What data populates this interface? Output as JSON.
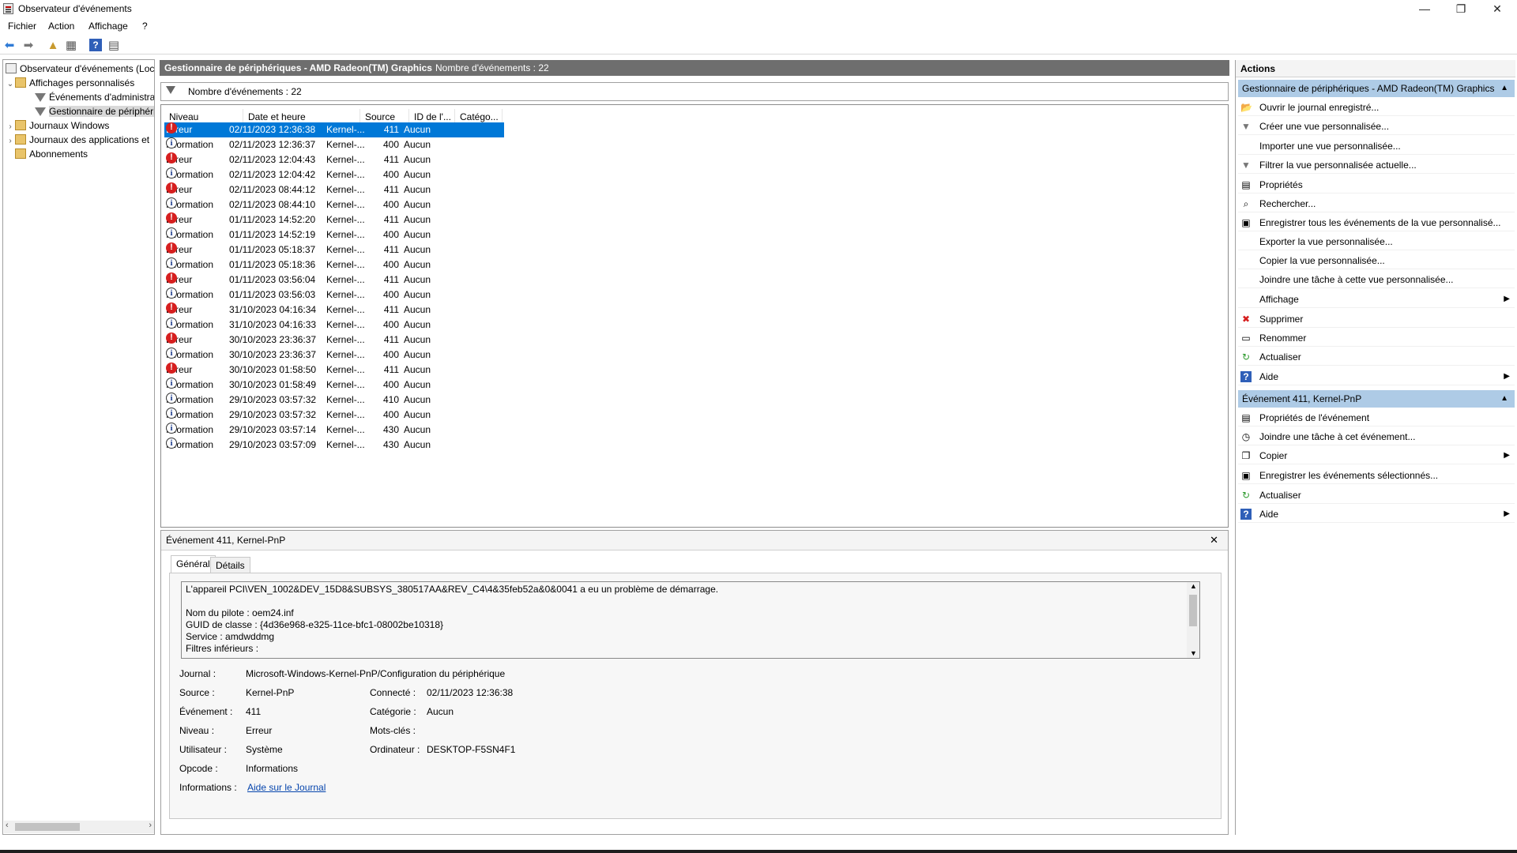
{
  "window": {
    "title": "Observateur d'événements",
    "minimize": "—",
    "maximize": "❐",
    "close": "✕"
  },
  "menu": [
    "Fichier",
    "Action",
    "Affichage",
    "?"
  ],
  "tree": {
    "root": "Observateur d'événements (Loc",
    "custom_views": "Affichages personnalisés",
    "admin_events": "Événements d'administra",
    "device_manager": "Gestionnaire de périphéri",
    "windows_logs": "Journaux Windows",
    "app_logs": "Journaux des applications et",
    "subscriptions": "Abonnements"
  },
  "center": {
    "header_title": "Gestionnaire de périphériques - AMD Radeon(TM) Graphics",
    "header_count": "Nombre d'événements : 22",
    "filter_text": "Nombre d'événements : 22",
    "columns": [
      "Niveau",
      "Date et heure",
      "Source",
      "ID de l'...",
      "Catégo..."
    ],
    "events": [
      {
        "level": "Erreur",
        "type": "err",
        "date": "02/11/2023 12:36:38",
        "source": "Kernel-...",
        "id": "411",
        "cat": "Aucun"
      },
      {
        "level": "Information",
        "type": "info",
        "date": "02/11/2023 12:36:37",
        "source": "Kernel-...",
        "id": "400",
        "cat": "Aucun"
      },
      {
        "level": "Erreur",
        "type": "err",
        "date": "02/11/2023 12:04:43",
        "source": "Kernel-...",
        "id": "411",
        "cat": "Aucun"
      },
      {
        "level": "Information",
        "type": "info",
        "date": "02/11/2023 12:04:42",
        "source": "Kernel-...",
        "id": "400",
        "cat": "Aucun"
      },
      {
        "level": "Erreur",
        "type": "err",
        "date": "02/11/2023 08:44:12",
        "source": "Kernel-...",
        "id": "411",
        "cat": "Aucun"
      },
      {
        "level": "Information",
        "type": "info",
        "date": "02/11/2023 08:44:10",
        "source": "Kernel-...",
        "id": "400",
        "cat": "Aucun"
      },
      {
        "level": "Erreur",
        "type": "err",
        "date": "01/11/2023 14:52:20",
        "source": "Kernel-...",
        "id": "411",
        "cat": "Aucun"
      },
      {
        "level": "Information",
        "type": "info",
        "date": "01/11/2023 14:52:19",
        "source": "Kernel-...",
        "id": "400",
        "cat": "Aucun"
      },
      {
        "level": "Erreur",
        "type": "err",
        "date": "01/11/2023 05:18:37",
        "source": "Kernel-...",
        "id": "411",
        "cat": "Aucun"
      },
      {
        "level": "Information",
        "type": "info",
        "date": "01/11/2023 05:18:36",
        "source": "Kernel-...",
        "id": "400",
        "cat": "Aucun"
      },
      {
        "level": "Erreur",
        "type": "err",
        "date": "01/11/2023 03:56:04",
        "source": "Kernel-...",
        "id": "411",
        "cat": "Aucun"
      },
      {
        "level": "Information",
        "type": "info",
        "date": "01/11/2023 03:56:03",
        "source": "Kernel-...",
        "id": "400",
        "cat": "Aucun"
      },
      {
        "level": "Erreur",
        "type": "err",
        "date": "31/10/2023 04:16:34",
        "source": "Kernel-...",
        "id": "411",
        "cat": "Aucun"
      },
      {
        "level": "Information",
        "type": "info",
        "date": "31/10/2023 04:16:33",
        "source": "Kernel-...",
        "id": "400",
        "cat": "Aucun"
      },
      {
        "level": "Erreur",
        "type": "err",
        "date": "30/10/2023 23:36:37",
        "source": "Kernel-...",
        "id": "411",
        "cat": "Aucun"
      },
      {
        "level": "Information",
        "type": "info",
        "date": "30/10/2023 23:36:37",
        "source": "Kernel-...",
        "id": "400",
        "cat": "Aucun"
      },
      {
        "level": "Erreur",
        "type": "err",
        "date": "30/10/2023 01:58:50",
        "source": "Kernel-...",
        "id": "411",
        "cat": "Aucun"
      },
      {
        "level": "Information",
        "type": "info",
        "date": "30/10/2023 01:58:49",
        "source": "Kernel-...",
        "id": "400",
        "cat": "Aucun"
      },
      {
        "level": "Information",
        "type": "info",
        "date": "29/10/2023 03:57:32",
        "source": "Kernel-...",
        "id": "410",
        "cat": "Aucun"
      },
      {
        "level": "Information",
        "type": "info",
        "date": "29/10/2023 03:57:32",
        "source": "Kernel-...",
        "id": "400",
        "cat": "Aucun"
      },
      {
        "level": "Information",
        "type": "info",
        "date": "29/10/2023 03:57:14",
        "source": "Kernel-...",
        "id": "430",
        "cat": "Aucun"
      },
      {
        "level": "Information",
        "type": "info",
        "date": "29/10/2023 03:57:09",
        "source": "Kernel-...",
        "id": "430",
        "cat": "Aucun"
      }
    ]
  },
  "detail": {
    "title": "Événement 411, Kernel-PnP",
    "tab_general": "Général",
    "tab_details": "Détails",
    "description": [
      "L'appareil PCI\\VEN_1002&DEV_15D8&SUBSYS_380517AA&REV_C4\\4&35feb52a&0&0041 a eu un problème de démarrage.",
      "",
      "Nom du pilote : oem24.inf",
      "GUID de classe : {4d36e968-e325-11ce-bfc1-08002be10318}",
      "Service : amdwddmg",
      "Filtres inférieurs :"
    ],
    "fields": {
      "journal_label": "Journal :",
      "journal": "Microsoft-Windows-Kernel-PnP/Configuration du périphérique",
      "source_label": "Source :",
      "source": "Kernel-PnP",
      "connected_label": "Connecté :",
      "connected": "02/11/2023 12:36:38",
      "event_label": "Événement :",
      "event": "411",
      "category_label": "Catégorie :",
      "category": "Aucun",
      "level_label": "Niveau :",
      "level": "Erreur",
      "keywords_label": "Mots-clés :",
      "user_label": "Utilisateur :",
      "user": "Système",
      "computer_label": "Ordinateur :",
      "computer": "DESKTOP-F5SN4F1",
      "opcode_label": "Opcode :",
      "opcode": "Informations",
      "info_label": "Informations :",
      "info_link": "Aide sur le Journal"
    }
  },
  "actions": {
    "header": "Actions",
    "section1": "Gestionnaire de périphériques - AMD Radeon(TM) Graphics",
    "items1": [
      {
        "label": "Ouvrir le journal enregistré...",
        "icon": "folder-icon",
        "glyph": "📂"
      },
      {
        "label": "Créer une vue personnalisée...",
        "icon": "filter-icon",
        "glyph": "▼"
      },
      {
        "label": "Importer une vue personnalisée...",
        "icon": "",
        "glyph": ""
      },
      {
        "label": "Filtrer la vue personnalisée actuelle...",
        "icon": "filter-icon",
        "glyph": "▼"
      },
      {
        "label": "Propriétés",
        "icon": "properties-icon",
        "glyph": "▤"
      },
      {
        "label": "Rechercher...",
        "icon": "binoculars-icon",
        "glyph": "⌕"
      },
      {
        "label": "Enregistrer tous les événements de la vue personnalisé...",
        "icon": "save-icon",
        "glyph": "▣"
      },
      {
        "label": "Exporter la vue personnalisée...",
        "icon": "",
        "glyph": ""
      },
      {
        "label": "Copier la vue personnalisée...",
        "icon": "",
        "glyph": ""
      },
      {
        "label": "Joindre une tâche à cette vue personnalisée...",
        "icon": "",
        "glyph": ""
      },
      {
        "label": "Affichage",
        "icon": "",
        "glyph": "",
        "sub": true
      },
      {
        "label": "Supprimer",
        "icon": "delete-icon",
        "glyph": "✖"
      },
      {
        "label": "Renommer",
        "icon": "rename-icon",
        "glyph": "▭"
      },
      {
        "label": "Actualiser",
        "icon": "refresh-icon",
        "glyph": "↻"
      },
      {
        "label": "Aide",
        "icon": "help-icon",
        "glyph": "?",
        "sub": true
      }
    ],
    "section2": "Événement 411, Kernel-PnP",
    "items2": [
      {
        "label": "Propriétés de l'événement",
        "icon": "properties-icon",
        "glyph": "▤"
      },
      {
        "label": "Joindre une tâche à cet événement...",
        "icon": "task-icon",
        "glyph": "◷"
      },
      {
        "label": "Copier",
        "icon": "copy-icon",
        "glyph": "❐",
        "sub": true
      },
      {
        "label": "Enregistrer les événements sélectionnés...",
        "icon": "save-icon",
        "glyph": "▣"
      },
      {
        "label": "Actualiser",
        "icon": "refresh-icon",
        "glyph": "↻"
      },
      {
        "label": "Aide",
        "icon": "help-icon",
        "glyph": "?",
        "sub": true
      }
    ]
  }
}
